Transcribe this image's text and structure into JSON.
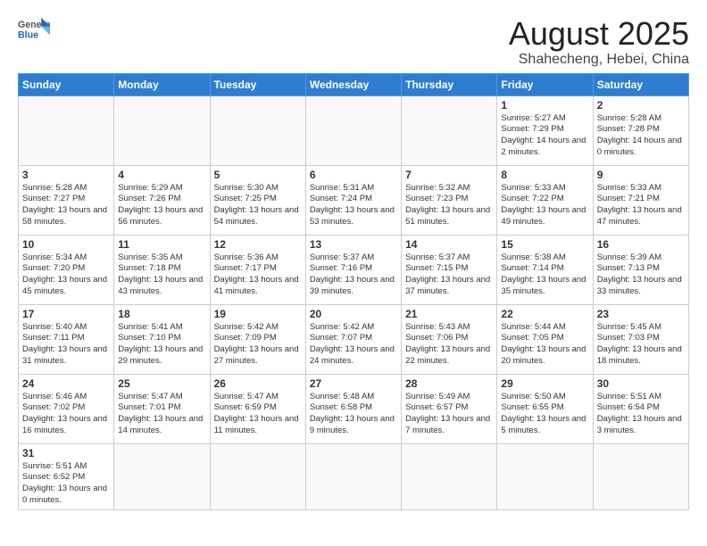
{
  "logo": {
    "text_general": "General",
    "text_blue": "Blue"
  },
  "title": "August 2025",
  "subtitle": "Shahecheng, Hebei, China",
  "weekdays": [
    "Sunday",
    "Monday",
    "Tuesday",
    "Wednesday",
    "Thursday",
    "Friday",
    "Saturday"
  ],
  "weeks": [
    [
      {
        "day": "",
        "info": ""
      },
      {
        "day": "",
        "info": ""
      },
      {
        "day": "",
        "info": ""
      },
      {
        "day": "",
        "info": ""
      },
      {
        "day": "",
        "info": ""
      },
      {
        "day": "1",
        "info": "Sunrise: 5:27 AM\nSunset: 7:29 PM\nDaylight: 14 hours and 2 minutes."
      },
      {
        "day": "2",
        "info": "Sunrise: 5:28 AM\nSunset: 7:28 PM\nDaylight: 14 hours and 0 minutes."
      }
    ],
    [
      {
        "day": "3",
        "info": "Sunrise: 5:28 AM\nSunset: 7:27 PM\nDaylight: 13 hours and 58 minutes."
      },
      {
        "day": "4",
        "info": "Sunrise: 5:29 AM\nSunset: 7:26 PM\nDaylight: 13 hours and 56 minutes."
      },
      {
        "day": "5",
        "info": "Sunrise: 5:30 AM\nSunset: 7:25 PM\nDaylight: 13 hours and 54 minutes."
      },
      {
        "day": "6",
        "info": "Sunrise: 5:31 AM\nSunset: 7:24 PM\nDaylight: 13 hours and 53 minutes."
      },
      {
        "day": "7",
        "info": "Sunrise: 5:32 AM\nSunset: 7:23 PM\nDaylight: 13 hours and 51 minutes."
      },
      {
        "day": "8",
        "info": "Sunrise: 5:33 AM\nSunset: 7:22 PM\nDaylight: 13 hours and 49 minutes."
      },
      {
        "day": "9",
        "info": "Sunrise: 5:33 AM\nSunset: 7:21 PM\nDaylight: 13 hours and 47 minutes."
      }
    ],
    [
      {
        "day": "10",
        "info": "Sunrise: 5:34 AM\nSunset: 7:20 PM\nDaylight: 13 hours and 45 minutes."
      },
      {
        "day": "11",
        "info": "Sunrise: 5:35 AM\nSunset: 7:18 PM\nDaylight: 13 hours and 43 minutes."
      },
      {
        "day": "12",
        "info": "Sunrise: 5:36 AM\nSunset: 7:17 PM\nDaylight: 13 hours and 41 minutes."
      },
      {
        "day": "13",
        "info": "Sunrise: 5:37 AM\nSunset: 7:16 PM\nDaylight: 13 hours and 39 minutes."
      },
      {
        "day": "14",
        "info": "Sunrise: 5:37 AM\nSunset: 7:15 PM\nDaylight: 13 hours and 37 minutes."
      },
      {
        "day": "15",
        "info": "Sunrise: 5:38 AM\nSunset: 7:14 PM\nDaylight: 13 hours and 35 minutes."
      },
      {
        "day": "16",
        "info": "Sunrise: 5:39 AM\nSunset: 7:13 PM\nDaylight: 13 hours and 33 minutes."
      }
    ],
    [
      {
        "day": "17",
        "info": "Sunrise: 5:40 AM\nSunset: 7:11 PM\nDaylight: 13 hours and 31 minutes."
      },
      {
        "day": "18",
        "info": "Sunrise: 5:41 AM\nSunset: 7:10 PM\nDaylight: 13 hours and 29 minutes."
      },
      {
        "day": "19",
        "info": "Sunrise: 5:42 AM\nSunset: 7:09 PM\nDaylight: 13 hours and 27 minutes."
      },
      {
        "day": "20",
        "info": "Sunrise: 5:42 AM\nSunset: 7:07 PM\nDaylight: 13 hours and 24 minutes."
      },
      {
        "day": "21",
        "info": "Sunrise: 5:43 AM\nSunset: 7:06 PM\nDaylight: 13 hours and 22 minutes."
      },
      {
        "day": "22",
        "info": "Sunrise: 5:44 AM\nSunset: 7:05 PM\nDaylight: 13 hours and 20 minutes."
      },
      {
        "day": "23",
        "info": "Sunrise: 5:45 AM\nSunset: 7:03 PM\nDaylight: 13 hours and 18 minutes."
      }
    ],
    [
      {
        "day": "24",
        "info": "Sunrise: 5:46 AM\nSunset: 7:02 PM\nDaylight: 13 hours and 16 minutes."
      },
      {
        "day": "25",
        "info": "Sunrise: 5:47 AM\nSunset: 7:01 PM\nDaylight: 13 hours and 14 minutes."
      },
      {
        "day": "26",
        "info": "Sunrise: 5:47 AM\nSunset: 6:59 PM\nDaylight: 13 hours and 11 minutes."
      },
      {
        "day": "27",
        "info": "Sunrise: 5:48 AM\nSunset: 6:58 PM\nDaylight: 13 hours and 9 minutes."
      },
      {
        "day": "28",
        "info": "Sunrise: 5:49 AM\nSunset: 6:57 PM\nDaylight: 13 hours and 7 minutes."
      },
      {
        "day": "29",
        "info": "Sunrise: 5:50 AM\nSunset: 6:55 PM\nDaylight: 13 hours and 5 minutes."
      },
      {
        "day": "30",
        "info": "Sunrise: 5:51 AM\nSunset: 6:54 PM\nDaylight: 13 hours and 3 minutes."
      }
    ],
    [
      {
        "day": "31",
        "info": "Sunrise: 5:51 AM\nSunset: 6:52 PM\nDaylight: 13 hours and 0 minutes."
      },
      {
        "day": "",
        "info": ""
      },
      {
        "day": "",
        "info": ""
      },
      {
        "day": "",
        "info": ""
      },
      {
        "day": "",
        "info": ""
      },
      {
        "day": "",
        "info": ""
      },
      {
        "day": "",
        "info": ""
      }
    ]
  ]
}
